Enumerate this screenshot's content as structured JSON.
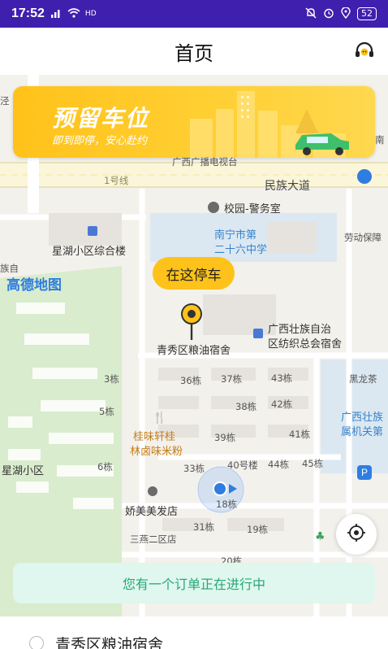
{
  "status_bar": {
    "time": "17:52",
    "network": "4G",
    "wifi": "HD",
    "battery": "52"
  },
  "header": {
    "title": "首页",
    "support_icon": "headset-icon"
  },
  "banner": {
    "title": "预留车位",
    "subtitle": "即到即停，安心赴约"
  },
  "map": {
    "brand": "高德地图",
    "park_here_label": "在这停车",
    "poi": {
      "broadcast": "广西广播电视台",
      "line1": "1号线",
      "road_minzu": "民族大道",
      "police": "校园-警务室",
      "school_1": "南宁市第",
      "school_2": "二十六中学",
      "labor": "劳动保障",
      "xinghu_complex": "星湖小区综合楼",
      "minzu_left": "族自",
      "gxzz_1": "广西壮族自治",
      "gxzz_2": "区纺织总会宿舍",
      "grain_dorm": "青秀区粮油宿舍",
      "heilongcha": "黑龙茶",
      "gx_right_1": "广西壮族",
      "gx_right_2": "属机关第",
      "guiwei_1": "桂味轩桂",
      "guiwei_2": "林卤味米粉",
      "xinghu_area": "星湖小区",
      "jiaomeimei": "娇美美发店",
      "sanyan": "三燕二区店",
      "b36": "36栋",
      "b37": "37栋",
      "b43": "43栋",
      "b38": "38栋",
      "b42": "42栋",
      "b39": "39栋",
      "b41": "41栋",
      "b33": "33栋",
      "b40": "40号楼",
      "b44": "44栋",
      "b45": "45栋",
      "b3": "3栋",
      "b5": "5栋",
      "b6": "6栋",
      "b18": "18栋",
      "b31": "31栋",
      "b19": "19栋",
      "b20": "20栋",
      "nan": "南",
      "jing": "泾"
    }
  },
  "order_notice": "您有一个订单正在进行中",
  "bottom_sheet": {
    "address": "青秀区粮油宿舍"
  },
  "colors": {
    "status_bar": "#3f1fae",
    "accent_yellow": "#ffc21a",
    "notice_bg": "#dff7ee",
    "notice_text": "#27a77a"
  }
}
